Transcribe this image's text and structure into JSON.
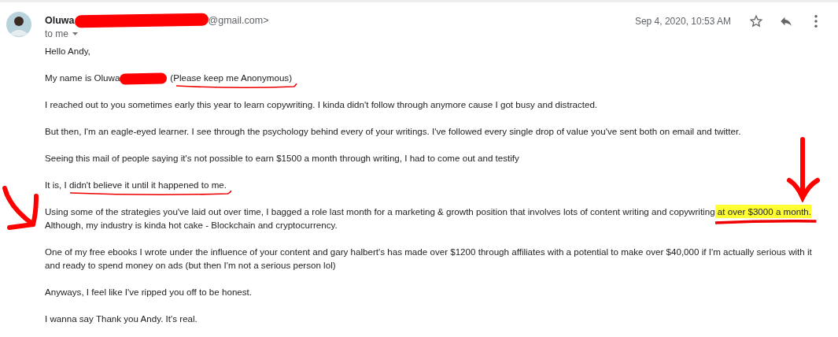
{
  "message": {
    "sender": [
      {
        "kind": "text",
        "text": "Oluwa"
      },
      {
        "kind": "redaction"
      },
      {
        "kind": "text",
        "text": "@gmail.com>"
      }
    ],
    "recipient": "to me",
    "date": "Sep 4, 2020, 10:53 AM",
    "starred": false,
    "paragraphs": [
      {
        "lines": [
          [
            {
              "kind": "text",
              "text": "Hello Andy,"
            }
          ]
        ]
      },
      {
        "lines": [
          [
            {
              "kind": "text",
              "text": "My name is Oluwa"
            },
            {
              "kind": "redaction"
            },
            {
              "kind": "underline",
              "text": "(Please keep me Anonymous)"
            }
          ]
        ]
      },
      {
        "lines": [
          [
            {
              "kind": "text",
              "text": "I reached out to you sometimes early this year to learn copywriting. I kinda didn't follow through anymore cause I got busy and distracted."
            }
          ]
        ]
      },
      {
        "lines": [
          [
            {
              "kind": "text",
              "text": "But then, I'm an eagle-eyed learner. I see through the psychology behind every of your writings. I've followed every single drop of value you've sent both on email and twitter."
            }
          ]
        ]
      },
      {
        "lines": [
          [
            {
              "kind": "text",
              "text": "Seeing this mail of people saying it's not possible to earn $1500 a month through writing, I had to come out and testify"
            }
          ]
        ]
      },
      {
        "lines": [
          [
            {
              "kind": "text",
              "text": "It is, "
            },
            {
              "kind": "underline",
              "text": "I didn't believe it until it happened to me."
            }
          ]
        ]
      },
      {
        "lines": [
          [
            {
              "kind": "text",
              "text": "Using some of the strategies you've laid out over time, I bagged a role last month for a marketing & growth position that involves lots of content writing and copywriting"
            },
            {
              "kind": "highlight",
              "text": " at over $3000 a month."
            }
          ],
          [
            {
              "kind": "text",
              "text": "Although, my industry is kinda hot cake - Blockchain and cryptocurrency."
            }
          ]
        ]
      },
      {
        "lines": [
          [
            {
              "kind": "text",
              "text": "One of my free ebooks I wrote under the influence of your content and gary halbert's has made over $1200 through affiliates with a potential to make over $40,000 if I'm actually serious with it"
            }
          ],
          [
            {
              "kind": "text",
              "text": "and ready to spend money on ads (but then I'm not a serious person lol)"
            }
          ]
        ]
      },
      {
        "lines": [
          [
            {
              "kind": "text",
              "text": "Anyways, I feel like I've ripped you off to be honest."
            }
          ]
        ]
      },
      {
        "lines": [
          [
            {
              "kind": "text",
              "text": "I wanna say Thank you Andy. It's real."
            }
          ]
        ]
      }
    ]
  },
  "annotations": [
    {
      "kind": "arrow-right"
    },
    {
      "kind": "arrow-down"
    }
  ]
}
